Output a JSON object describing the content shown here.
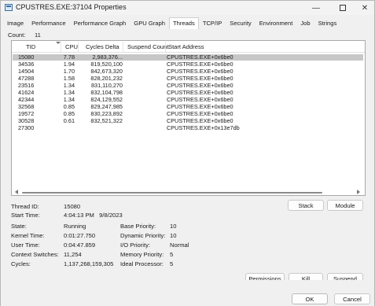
{
  "window": {
    "title": "CPUSTRES.EXE:37104 Properties"
  },
  "tabs": [
    {
      "label": "Image"
    },
    {
      "label": "Performance"
    },
    {
      "label": "Performance Graph"
    },
    {
      "label": "GPU Graph"
    },
    {
      "label": "Threads",
      "active": true
    },
    {
      "label": "TCP/IP"
    },
    {
      "label": "Security"
    },
    {
      "label": "Environment"
    },
    {
      "label": "Job"
    },
    {
      "label": "Strings"
    }
  ],
  "count": {
    "label": "Count:",
    "value": "11"
  },
  "list": {
    "columns": {
      "tid": "TID",
      "cpu": "CPU",
      "cycles": "Cycles Delta",
      "suspend": "Suspend Count",
      "address": "Start Address"
    },
    "rows": [
      {
        "tid": "15080",
        "cpu": "7.78",
        "cycles": "2,983,376...",
        "suspend": "",
        "address": "CPUSTRES.EXE+0x6be0",
        "selected": true
      },
      {
        "tid": "34536",
        "cpu": "1.94",
        "cycles": "819,520,100",
        "suspend": "",
        "address": "CPUSTRES.EXE+0x6be0"
      },
      {
        "tid": "14504",
        "cpu": "1.70",
        "cycles": "842,673,320",
        "suspend": "",
        "address": "CPUSTRES.EXE+0x6be0"
      },
      {
        "tid": "47288",
        "cpu": "1.58",
        "cycles": "828,201,232",
        "suspend": "",
        "address": "CPUSTRES.EXE+0x6be0"
      },
      {
        "tid": "23516",
        "cpu": "1.34",
        "cycles": "831,110,270",
        "suspend": "",
        "address": "CPUSTRES.EXE+0x6be0"
      },
      {
        "tid": "41624",
        "cpu": "1.34",
        "cycles": "832,104,798",
        "suspend": "",
        "address": "CPUSTRES.EXE+0x6be0"
      },
      {
        "tid": "42344",
        "cpu": "1.34",
        "cycles": "824,129,552",
        "suspend": "",
        "address": "CPUSTRES.EXE+0x6be0"
      },
      {
        "tid": "32568",
        "cpu": "0.85",
        "cycles": "829,247,985",
        "suspend": "",
        "address": "CPUSTRES.EXE+0x6be0"
      },
      {
        "tid": "19572",
        "cpu": "0.85",
        "cycles": "830,223,892",
        "suspend": "",
        "address": "CPUSTRES.EXE+0x6be0"
      },
      {
        "tid": "30528",
        "cpu": "0.61",
        "cycles": "832,521,322",
        "suspend": "",
        "address": "CPUSTRES.EXE+0x6be0"
      },
      {
        "tid": "27300",
        "cpu": "",
        "cycles": "",
        "suspend": "",
        "address": "CPUSTRES.EXE+0x13e7db"
      }
    ]
  },
  "details": {
    "thread_id": {
      "label": "Thread ID:",
      "value": "15080"
    },
    "start_time": {
      "label": "Start Time:",
      "value": "4:04:13 PM   9/8/2023"
    },
    "state": {
      "label": "State:",
      "value": "Running"
    },
    "kernel_time": {
      "label": "Kernel Time:",
      "value": "0:01:27.750"
    },
    "user_time": {
      "label": "User Time:",
      "value": "0:04:47.859"
    },
    "context_switches": {
      "label": "Context Switches:",
      "value": "11,254"
    },
    "cycles": {
      "label": "Cycles:",
      "value": "1,137,268,159,305"
    },
    "base_priority": {
      "label": "Base Priority:",
      "value": "10"
    },
    "dynamic_priority": {
      "label": "Dynamic Priority:",
      "value": "10"
    },
    "io_priority": {
      "label": "I/O Priority:",
      "value": "Normal"
    },
    "memory_priority": {
      "label": "Memory Priority:",
      "value": "5"
    },
    "ideal_processor": {
      "label": "Ideal Processor:",
      "value": "5"
    }
  },
  "buttons": {
    "stack": "Stack",
    "module": "Module",
    "permissions": "Permissions",
    "kill": "Kill",
    "suspend": "Suspend",
    "ok": "OK",
    "cancel": "Cancel"
  },
  "icons": {
    "app": "app-window-icon",
    "minimize": "minimize-icon",
    "maximize": "maximize-icon",
    "close": "close-icon"
  }
}
